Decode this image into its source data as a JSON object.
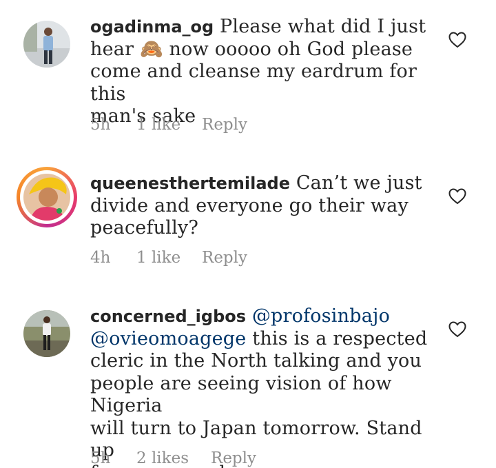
{
  "comments": [
    {
      "username": "ogadinma_og",
      "text_lines": [
        "Please what did I just",
        "hear 🙈 now ooooo oh God please",
        "come and cleanse my eardrum for this",
        "man's sake"
      ],
      "time": "5h",
      "likes": "1 like",
      "reply": "Reply",
      "avatar": "person-standing-avatar"
    },
    {
      "username": "queenesthertemilade",
      "text_lines": [
        "Can’t we just",
        "divide and everyone go their way",
        "peacefully?"
      ],
      "time": "4h",
      "likes": "1 like",
      "reply": "Reply",
      "avatar": "woman-with-gele-avatar"
    },
    {
      "username": "concerned_igbos",
      "mentions": [
        "@profosinbajo",
        "@ovieomoagege"
      ],
      "text_lines": [
        "this is a respected",
        "cleric in the North talking and you",
        "people are seeing vision of how Nigeria",
        "will turn to  Japan tomorrow. Stand up",
        "for your people now."
      ],
      "time": "5h",
      "likes": "2 likes",
      "reply": "Reply",
      "avatar": "person-outdoors-avatar"
    }
  ],
  "colors": {
    "text": "#262626",
    "meta": "#8e8e8e",
    "mention": "#003569",
    "story_ring_start": "#f9a33b",
    "story_ring_end": "#c22d8f"
  }
}
